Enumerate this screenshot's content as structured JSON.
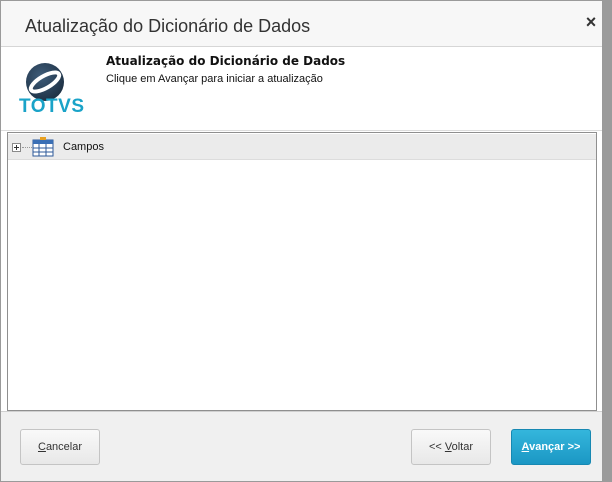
{
  "window": {
    "title": "Atualização do Dicionário de Dados",
    "close_glyph": "×"
  },
  "header": {
    "logo_text": "TOTVS",
    "title": "Atualização do Dicionário de Dados",
    "subtitle": "Clique em Avançar para iniciar a atualização"
  },
  "tree": {
    "items": [
      {
        "label": "Campos",
        "icon": "table-icon",
        "expanded": false
      }
    ]
  },
  "footer": {
    "cancel_mnemonic": "C",
    "cancel_rest": "ancelar",
    "back_prefix": "<< ",
    "back_mnemonic": "V",
    "back_rest": "oltar",
    "next_mnemonic": "A",
    "next_rest": "vançar >>"
  },
  "colors": {
    "accent": "#1aa3c8",
    "primary_button": "#1b97c4"
  }
}
